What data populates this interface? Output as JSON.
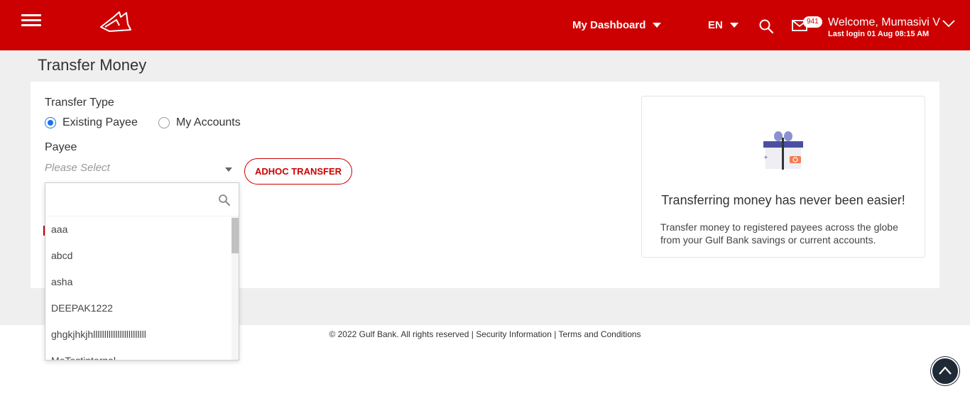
{
  "header": {
    "dashboard_label": "My Dashboard",
    "language": "EN",
    "mail_count": "941",
    "welcome": "Welcome, Mumasivi V",
    "last_login": "Last login 01 Aug 08:15 AM",
    "bg_color": "#cc0000"
  },
  "page": {
    "title": "Transfer Money"
  },
  "form": {
    "transfer_type_label": "Transfer Type",
    "options": [
      {
        "label": "Existing Payee",
        "selected": true
      },
      {
        "label": "My Accounts",
        "selected": false
      }
    ],
    "payee_label": "Payee",
    "payee_placeholder": "Please Select",
    "adhoc_button": "ADHOC TRANSFER"
  },
  "dropdown": {
    "search_value": "",
    "items": [
      "aaa",
      "abcd",
      "asha",
      "DEEPAK1222",
      "ghgkjhkjhllllllllllllllllllllllll",
      "MeTestinternal"
    ]
  },
  "info_card": {
    "title": "Transferring money has never been easier!",
    "description": "Transfer money to registered payees across the globe from your Gulf Bank savings or current accounts."
  },
  "footer": {
    "copyright": "© 2022 Gulf Bank. All rights reserved",
    "links": [
      "Security Information",
      "Terms and Conditions"
    ],
    "separator": " | "
  }
}
